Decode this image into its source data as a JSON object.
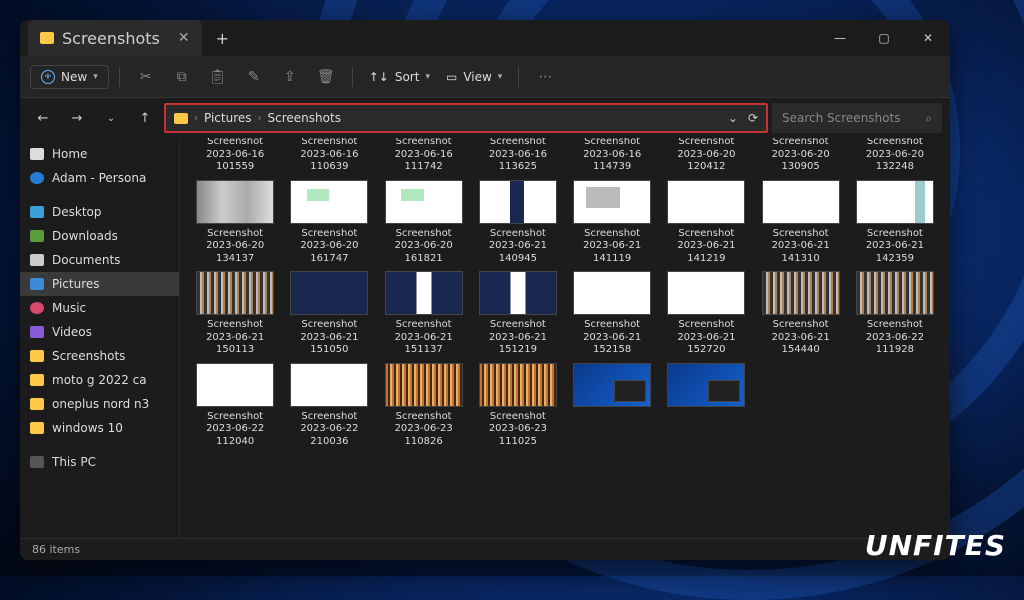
{
  "titlebar": {
    "tab_title": "Screenshots"
  },
  "toolbar": {
    "new_label": "New",
    "sort_label": "Sort",
    "view_label": "View"
  },
  "breadcrumb": {
    "seg1": "Pictures",
    "seg2": "Screenshots"
  },
  "search": {
    "placeholder": "Search Screenshots"
  },
  "sidebar": {
    "home": "Home",
    "onedrive": "Adam - Persona",
    "desktop": "Desktop",
    "downloads": "Downloads",
    "documents": "Documents",
    "pictures": "Pictures",
    "music": "Music",
    "videos": "Videos",
    "screenshots": "Screenshots",
    "motog": "moto g 2022 ca",
    "oneplus": "oneplus nord n3",
    "win10": "windows 10",
    "thispc": "This PC"
  },
  "status": {
    "count": "86 items"
  },
  "watermark": "UNFITES",
  "files": {
    "r0": [
      {
        "l1": "Screenshot",
        "l2": "2023-06-16",
        "l3": "101559"
      },
      {
        "l1": "Screenshot",
        "l2": "2023-06-16",
        "l3": "110639"
      },
      {
        "l1": "Screenshot",
        "l2": "2023-06-16",
        "l3": "111742"
      },
      {
        "l1": "Screenshot",
        "l2": "2023-06-16",
        "l3": "113625"
      },
      {
        "l1": "Screenshot",
        "l2": "2023-06-16",
        "l3": "114739"
      },
      {
        "l1": "Screenshot",
        "l2": "2023-06-20",
        "l3": "120412"
      },
      {
        "l1": "Screenshot",
        "l2": "2023-06-20",
        "l3": "130905"
      },
      {
        "l1": "Screenshot",
        "l2": "2023-06-20",
        "l3": "132248"
      }
    ],
    "r1": [
      {
        "l1": "Screenshot",
        "l2": "2023-06-20",
        "l3": "134137"
      },
      {
        "l1": "Screenshot",
        "l2": "2023-06-20",
        "l3": "161747"
      },
      {
        "l1": "Screenshot",
        "l2": "2023-06-20",
        "l3": "161821"
      },
      {
        "l1": "Screenshot",
        "l2": "2023-06-21",
        "l3": "140945"
      },
      {
        "l1": "Screenshot",
        "l2": "2023-06-21",
        "l3": "141119"
      },
      {
        "l1": "Screenshot",
        "l2": "2023-06-21",
        "l3": "141219"
      },
      {
        "l1": "Screenshot",
        "l2": "2023-06-21",
        "l3": "141310"
      },
      {
        "l1": "Screenshot",
        "l2": "2023-06-21",
        "l3": "142359"
      }
    ],
    "r2": [
      {
        "l1": "Screenshot",
        "l2": "2023-06-21",
        "l3": "150113"
      },
      {
        "l1": "Screenshot",
        "l2": "2023-06-21",
        "l3": "151050"
      },
      {
        "l1": "Screenshot",
        "l2": "2023-06-21",
        "l3": "151137"
      },
      {
        "l1": "Screenshot",
        "l2": "2023-06-21",
        "l3": "151219"
      },
      {
        "l1": "Screenshot",
        "l2": "2023-06-21",
        "l3": "152158"
      },
      {
        "l1": "Screenshot",
        "l2": "2023-06-21",
        "l3": "152720"
      },
      {
        "l1": "Screenshot",
        "l2": "2023-06-21",
        "l3": "154440"
      },
      {
        "l1": "Screenshot",
        "l2": "2023-06-22",
        "l3": "111928"
      }
    ],
    "r3": [
      {
        "l1": "Screenshot",
        "l2": "2023-06-22",
        "l3": "112040"
      },
      {
        "l1": "Screenshot",
        "l2": "2023-06-22",
        "l3": "210036"
      },
      {
        "l1": "Screenshot",
        "l2": "2023-06-23",
        "l3": "110826"
      },
      {
        "l1": "Screenshot",
        "l2": "2023-06-23",
        "l3": "111025"
      }
    ]
  }
}
